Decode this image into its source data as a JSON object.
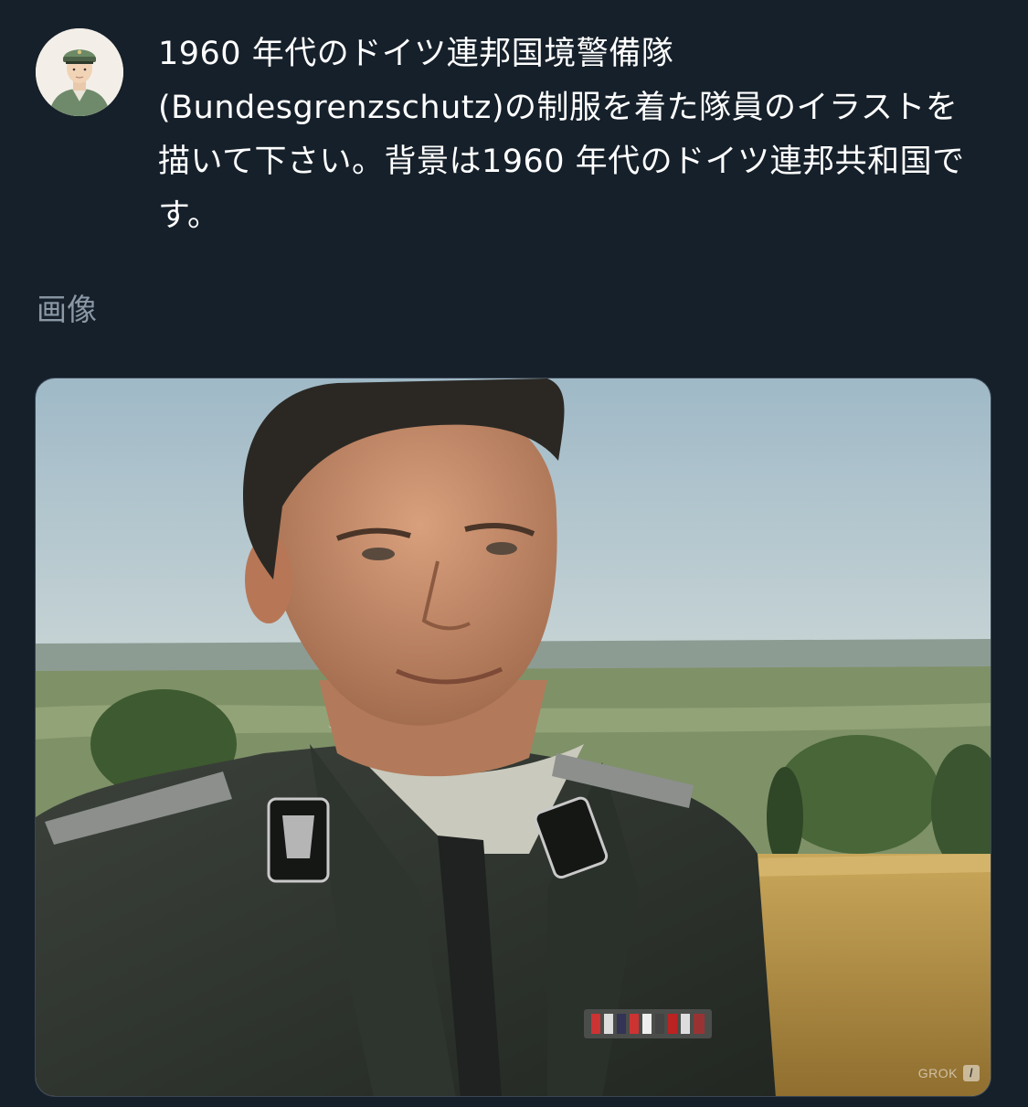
{
  "post": {
    "avatar_icon": "profile-avatar",
    "prompt_text": "1960 年代のドイツ連邦国境警備隊(Bundesgrenzschutz)の制服を着た隊員のイラストを描いて下さい。背景は1960 年代のドイツ連邦共和国です。"
  },
  "image_section": {
    "label": "画像"
  },
  "generated_image": {
    "watermark": "GROK",
    "watermark_icon": "slash-icon"
  }
}
